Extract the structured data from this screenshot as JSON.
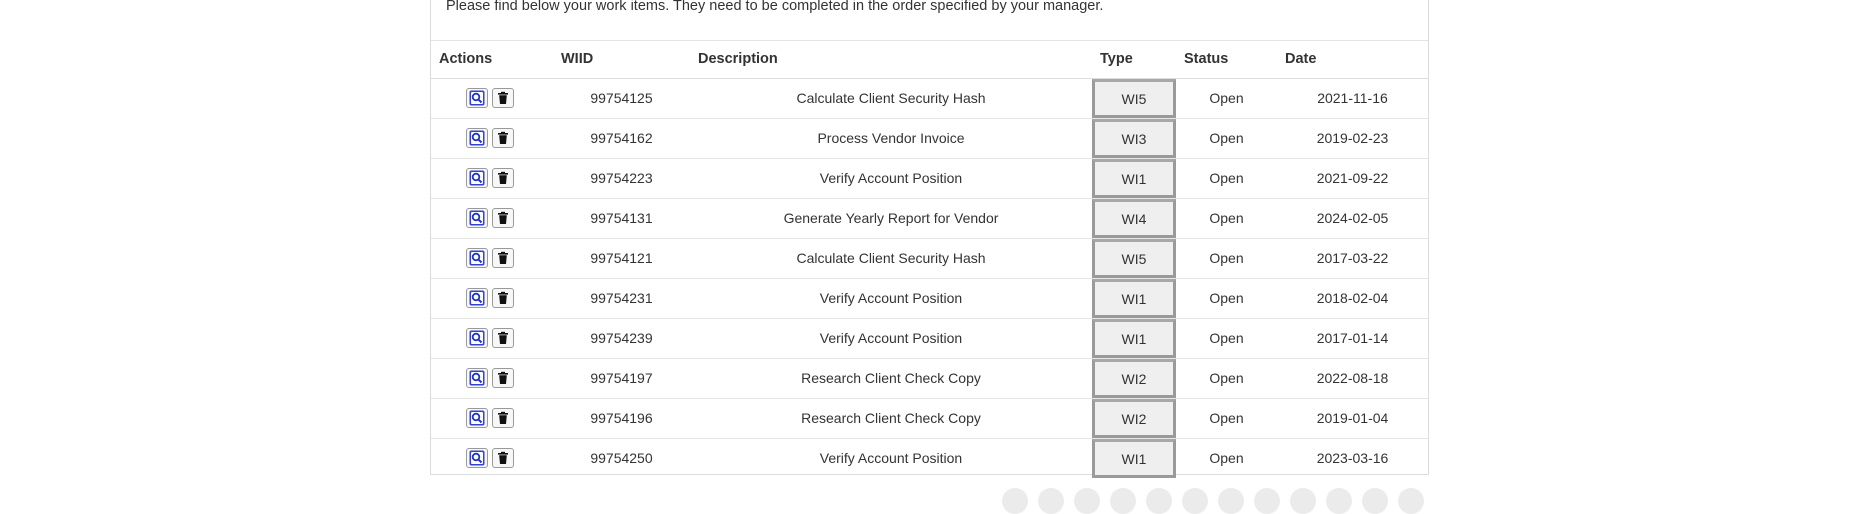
{
  "intro_text": "Please find below your work items. They need to be completed in the order specified by your manager.",
  "table": {
    "headers": {
      "actions": "Actions",
      "wiid": "WIID",
      "description": "Description",
      "type": "Type",
      "status": "Status",
      "date": "Date"
    },
    "rows": [
      {
        "wiid": "99754125",
        "description": "Calculate Client Security Hash",
        "type": "WI5",
        "status": "Open",
        "date": "2021-11-16"
      },
      {
        "wiid": "99754162",
        "description": "Process Vendor Invoice",
        "type": "WI3",
        "status": "Open",
        "date": "2019-02-23"
      },
      {
        "wiid": "99754223",
        "description": "Verify Account Position",
        "type": "WI1",
        "status": "Open",
        "date": "2021-09-22"
      },
      {
        "wiid": "99754131",
        "description": "Generate Yearly Report for Vendor",
        "type": "WI4",
        "status": "Open",
        "date": "2024-02-05"
      },
      {
        "wiid": "99754121",
        "description": "Calculate Client Security Hash",
        "type": "WI5",
        "status": "Open",
        "date": "2017-03-22"
      },
      {
        "wiid": "99754231",
        "description": "Verify Account Position",
        "type": "WI1",
        "status": "Open",
        "date": "2018-02-04"
      },
      {
        "wiid": "99754239",
        "description": "Verify Account Position",
        "type": "WI1",
        "status": "Open",
        "date": "2017-01-14"
      },
      {
        "wiid": "99754197",
        "description": "Research Client Check Copy",
        "type": "WI2",
        "status": "Open",
        "date": "2022-08-18"
      },
      {
        "wiid": "99754196",
        "description": "Research Client Check Copy",
        "type": "WI2",
        "status": "Open",
        "date": "2019-01-04"
      },
      {
        "wiid": "99754250",
        "description": "Verify Account Position",
        "type": "WI1",
        "status": "Open",
        "date": "2023-03-16"
      }
    ]
  },
  "icons": {
    "view": "magnifier-icon",
    "delete": "trash-icon"
  },
  "colors": {
    "view_icon": "#2f3fcf",
    "delete_icon": "#111111"
  },
  "pagination_dot_count": 12
}
